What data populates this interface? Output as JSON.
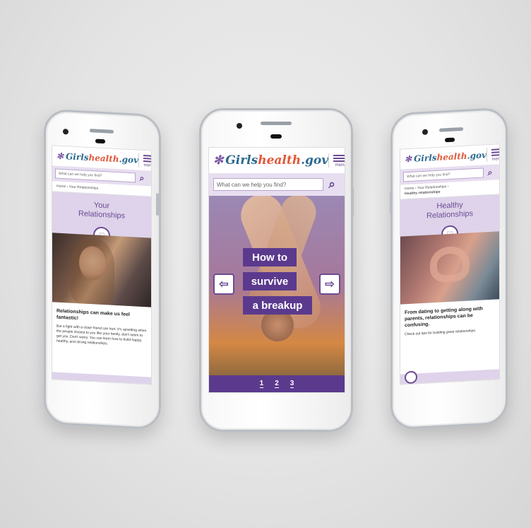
{
  "logo": {
    "mark": "✻",
    "girls": "Girls",
    "health": "health",
    "gov": ".gov"
  },
  "menu_label": "menu",
  "search_placeholder": "What can we help you find?",
  "left": {
    "breadcrumb": "Home › Your Relationships",
    "title": "Your Relationships",
    "headline": "Relationships can make us feel fantastic!",
    "body": "But a fight with a close friend can hurt. It's upsetting when the people closest to you like your family, don't seem to get you. Don't worry. You can learn how to build happy, healthy, and strong relationships."
  },
  "center": {
    "headline_lines": [
      "How to",
      "survive",
      "a breakup"
    ],
    "pages": [
      "1",
      "2",
      "3"
    ]
  },
  "right": {
    "breadcrumb_1": "Home › Your Relationships ›",
    "breadcrumb_2": "Healthy relationships",
    "title": "Healthy Relationships",
    "headline": "From dating to getting along with parents, relationships can be confusing.",
    "body": "Check out tips for building great relationships."
  },
  "colors": {
    "purple": "#5b3a8e",
    "lavender": "#ded3ea",
    "orange": "#e0593a",
    "blue": "#2c6a8f"
  }
}
